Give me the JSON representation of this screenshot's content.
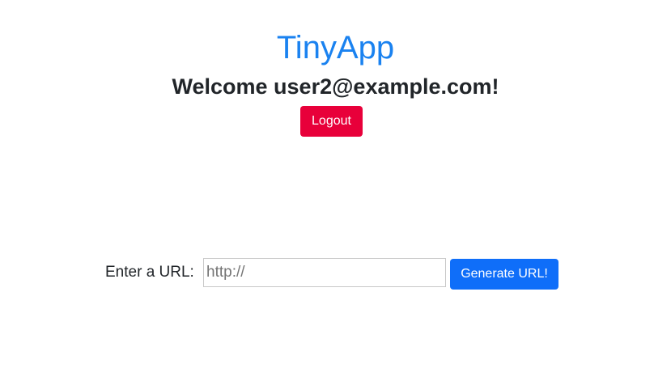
{
  "header": {
    "app_title": "TinyApp",
    "welcome_text": "Welcome user2@example.com!",
    "logout_label": "Logout"
  },
  "url_form": {
    "label": "Enter a URL:",
    "input_value": "",
    "input_placeholder": "http://",
    "submit_label": "Generate URL!"
  },
  "colors": {
    "brand": "#1a82f0",
    "logout": "#e8003a",
    "primary_button": "#0f6ef9",
    "text": "#212529"
  }
}
